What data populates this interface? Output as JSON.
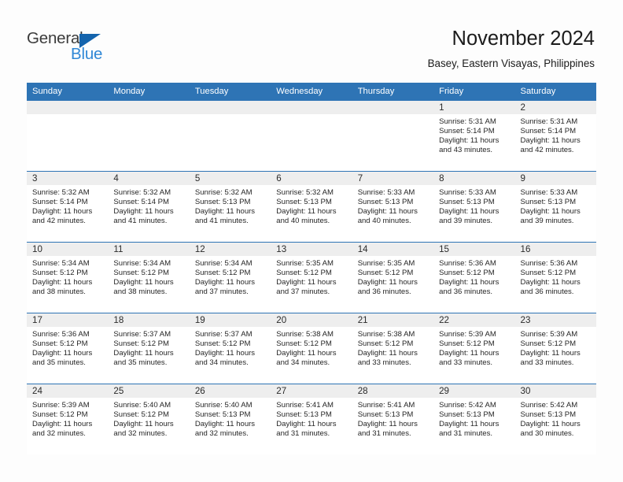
{
  "logo": {
    "word1": "General",
    "word2": "Blue",
    "triangle_color": "#1464ad",
    "word2_color": "#2f87d6",
    "word1_color": "#3b3b3b"
  },
  "header": {
    "month_title": "November 2024",
    "location": "Basey, Eastern Visayas, Philippines",
    "accent_color": "#2e74b5"
  },
  "calendar": {
    "weekdays": [
      "Sunday",
      "Monday",
      "Tuesday",
      "Wednesday",
      "Thursday",
      "Friday",
      "Saturday"
    ],
    "weeks": [
      [
        {
          "day": "",
          "sunrise": "",
          "sunset": "",
          "daylight1": "",
          "daylight2": "",
          "blank": true
        },
        {
          "day": "",
          "sunrise": "",
          "sunset": "",
          "daylight1": "",
          "daylight2": "",
          "blank": true
        },
        {
          "day": "",
          "sunrise": "",
          "sunset": "",
          "daylight1": "",
          "daylight2": "",
          "blank": true
        },
        {
          "day": "",
          "sunrise": "",
          "sunset": "",
          "daylight1": "",
          "daylight2": "",
          "blank": true
        },
        {
          "day": "",
          "sunrise": "",
          "sunset": "",
          "daylight1": "",
          "daylight2": "",
          "blank": true
        },
        {
          "day": "1",
          "sunrise": "Sunrise: 5:31 AM",
          "sunset": "Sunset: 5:14 PM",
          "daylight1": "Daylight: 11 hours",
          "daylight2": "and 43 minutes."
        },
        {
          "day": "2",
          "sunrise": "Sunrise: 5:31 AM",
          "sunset": "Sunset: 5:14 PM",
          "daylight1": "Daylight: 11 hours",
          "daylight2": "and 42 minutes."
        }
      ],
      [
        {
          "day": "3",
          "sunrise": "Sunrise: 5:32 AM",
          "sunset": "Sunset: 5:14 PM",
          "daylight1": "Daylight: 11 hours",
          "daylight2": "and 42 minutes."
        },
        {
          "day": "4",
          "sunrise": "Sunrise: 5:32 AM",
          "sunset": "Sunset: 5:14 PM",
          "daylight1": "Daylight: 11 hours",
          "daylight2": "and 41 minutes."
        },
        {
          "day": "5",
          "sunrise": "Sunrise: 5:32 AM",
          "sunset": "Sunset: 5:13 PM",
          "daylight1": "Daylight: 11 hours",
          "daylight2": "and 41 minutes."
        },
        {
          "day": "6",
          "sunrise": "Sunrise: 5:32 AM",
          "sunset": "Sunset: 5:13 PM",
          "daylight1": "Daylight: 11 hours",
          "daylight2": "and 40 minutes."
        },
        {
          "day": "7",
          "sunrise": "Sunrise: 5:33 AM",
          "sunset": "Sunset: 5:13 PM",
          "daylight1": "Daylight: 11 hours",
          "daylight2": "and 40 minutes."
        },
        {
          "day": "8",
          "sunrise": "Sunrise: 5:33 AM",
          "sunset": "Sunset: 5:13 PM",
          "daylight1": "Daylight: 11 hours",
          "daylight2": "and 39 minutes."
        },
        {
          "day": "9",
          "sunrise": "Sunrise: 5:33 AM",
          "sunset": "Sunset: 5:13 PM",
          "daylight1": "Daylight: 11 hours",
          "daylight2": "and 39 minutes."
        }
      ],
      [
        {
          "day": "10",
          "sunrise": "Sunrise: 5:34 AM",
          "sunset": "Sunset: 5:12 PM",
          "daylight1": "Daylight: 11 hours",
          "daylight2": "and 38 minutes."
        },
        {
          "day": "11",
          "sunrise": "Sunrise: 5:34 AM",
          "sunset": "Sunset: 5:12 PM",
          "daylight1": "Daylight: 11 hours",
          "daylight2": "and 38 minutes."
        },
        {
          "day": "12",
          "sunrise": "Sunrise: 5:34 AM",
          "sunset": "Sunset: 5:12 PM",
          "daylight1": "Daylight: 11 hours",
          "daylight2": "and 37 minutes."
        },
        {
          "day": "13",
          "sunrise": "Sunrise: 5:35 AM",
          "sunset": "Sunset: 5:12 PM",
          "daylight1": "Daylight: 11 hours",
          "daylight2": "and 37 minutes."
        },
        {
          "day": "14",
          "sunrise": "Sunrise: 5:35 AM",
          "sunset": "Sunset: 5:12 PM",
          "daylight1": "Daylight: 11 hours",
          "daylight2": "and 36 minutes."
        },
        {
          "day": "15",
          "sunrise": "Sunrise: 5:36 AM",
          "sunset": "Sunset: 5:12 PM",
          "daylight1": "Daylight: 11 hours",
          "daylight2": "and 36 minutes."
        },
        {
          "day": "16",
          "sunrise": "Sunrise: 5:36 AM",
          "sunset": "Sunset: 5:12 PM",
          "daylight1": "Daylight: 11 hours",
          "daylight2": "and 36 minutes."
        }
      ],
      [
        {
          "day": "17",
          "sunrise": "Sunrise: 5:36 AM",
          "sunset": "Sunset: 5:12 PM",
          "daylight1": "Daylight: 11 hours",
          "daylight2": "and 35 minutes."
        },
        {
          "day": "18",
          "sunrise": "Sunrise: 5:37 AM",
          "sunset": "Sunset: 5:12 PM",
          "daylight1": "Daylight: 11 hours",
          "daylight2": "and 35 minutes."
        },
        {
          "day": "19",
          "sunrise": "Sunrise: 5:37 AM",
          "sunset": "Sunset: 5:12 PM",
          "daylight1": "Daylight: 11 hours",
          "daylight2": "and 34 minutes."
        },
        {
          "day": "20",
          "sunrise": "Sunrise: 5:38 AM",
          "sunset": "Sunset: 5:12 PM",
          "daylight1": "Daylight: 11 hours",
          "daylight2": "and 34 minutes."
        },
        {
          "day": "21",
          "sunrise": "Sunrise: 5:38 AM",
          "sunset": "Sunset: 5:12 PM",
          "daylight1": "Daylight: 11 hours",
          "daylight2": "and 33 minutes."
        },
        {
          "day": "22",
          "sunrise": "Sunrise: 5:39 AM",
          "sunset": "Sunset: 5:12 PM",
          "daylight1": "Daylight: 11 hours",
          "daylight2": "and 33 minutes."
        },
        {
          "day": "23",
          "sunrise": "Sunrise: 5:39 AM",
          "sunset": "Sunset: 5:12 PM",
          "daylight1": "Daylight: 11 hours",
          "daylight2": "and 33 minutes."
        }
      ],
      [
        {
          "day": "24",
          "sunrise": "Sunrise: 5:39 AM",
          "sunset": "Sunset: 5:12 PM",
          "daylight1": "Daylight: 11 hours",
          "daylight2": "and 32 minutes."
        },
        {
          "day": "25",
          "sunrise": "Sunrise: 5:40 AM",
          "sunset": "Sunset: 5:12 PM",
          "daylight1": "Daylight: 11 hours",
          "daylight2": "and 32 minutes."
        },
        {
          "day": "26",
          "sunrise": "Sunrise: 5:40 AM",
          "sunset": "Sunset: 5:13 PM",
          "daylight1": "Daylight: 11 hours",
          "daylight2": "and 32 minutes."
        },
        {
          "day": "27",
          "sunrise": "Sunrise: 5:41 AM",
          "sunset": "Sunset: 5:13 PM",
          "daylight1": "Daylight: 11 hours",
          "daylight2": "and 31 minutes."
        },
        {
          "day": "28",
          "sunrise": "Sunrise: 5:41 AM",
          "sunset": "Sunset: 5:13 PM",
          "daylight1": "Daylight: 11 hours",
          "daylight2": "and 31 minutes."
        },
        {
          "day": "29",
          "sunrise": "Sunrise: 5:42 AM",
          "sunset": "Sunset: 5:13 PM",
          "daylight1": "Daylight: 11 hours",
          "daylight2": "and 31 minutes."
        },
        {
          "day": "30",
          "sunrise": "Sunrise: 5:42 AM",
          "sunset": "Sunset: 5:13 PM",
          "daylight1": "Daylight: 11 hours",
          "daylight2": "and 30 minutes."
        }
      ]
    ]
  }
}
